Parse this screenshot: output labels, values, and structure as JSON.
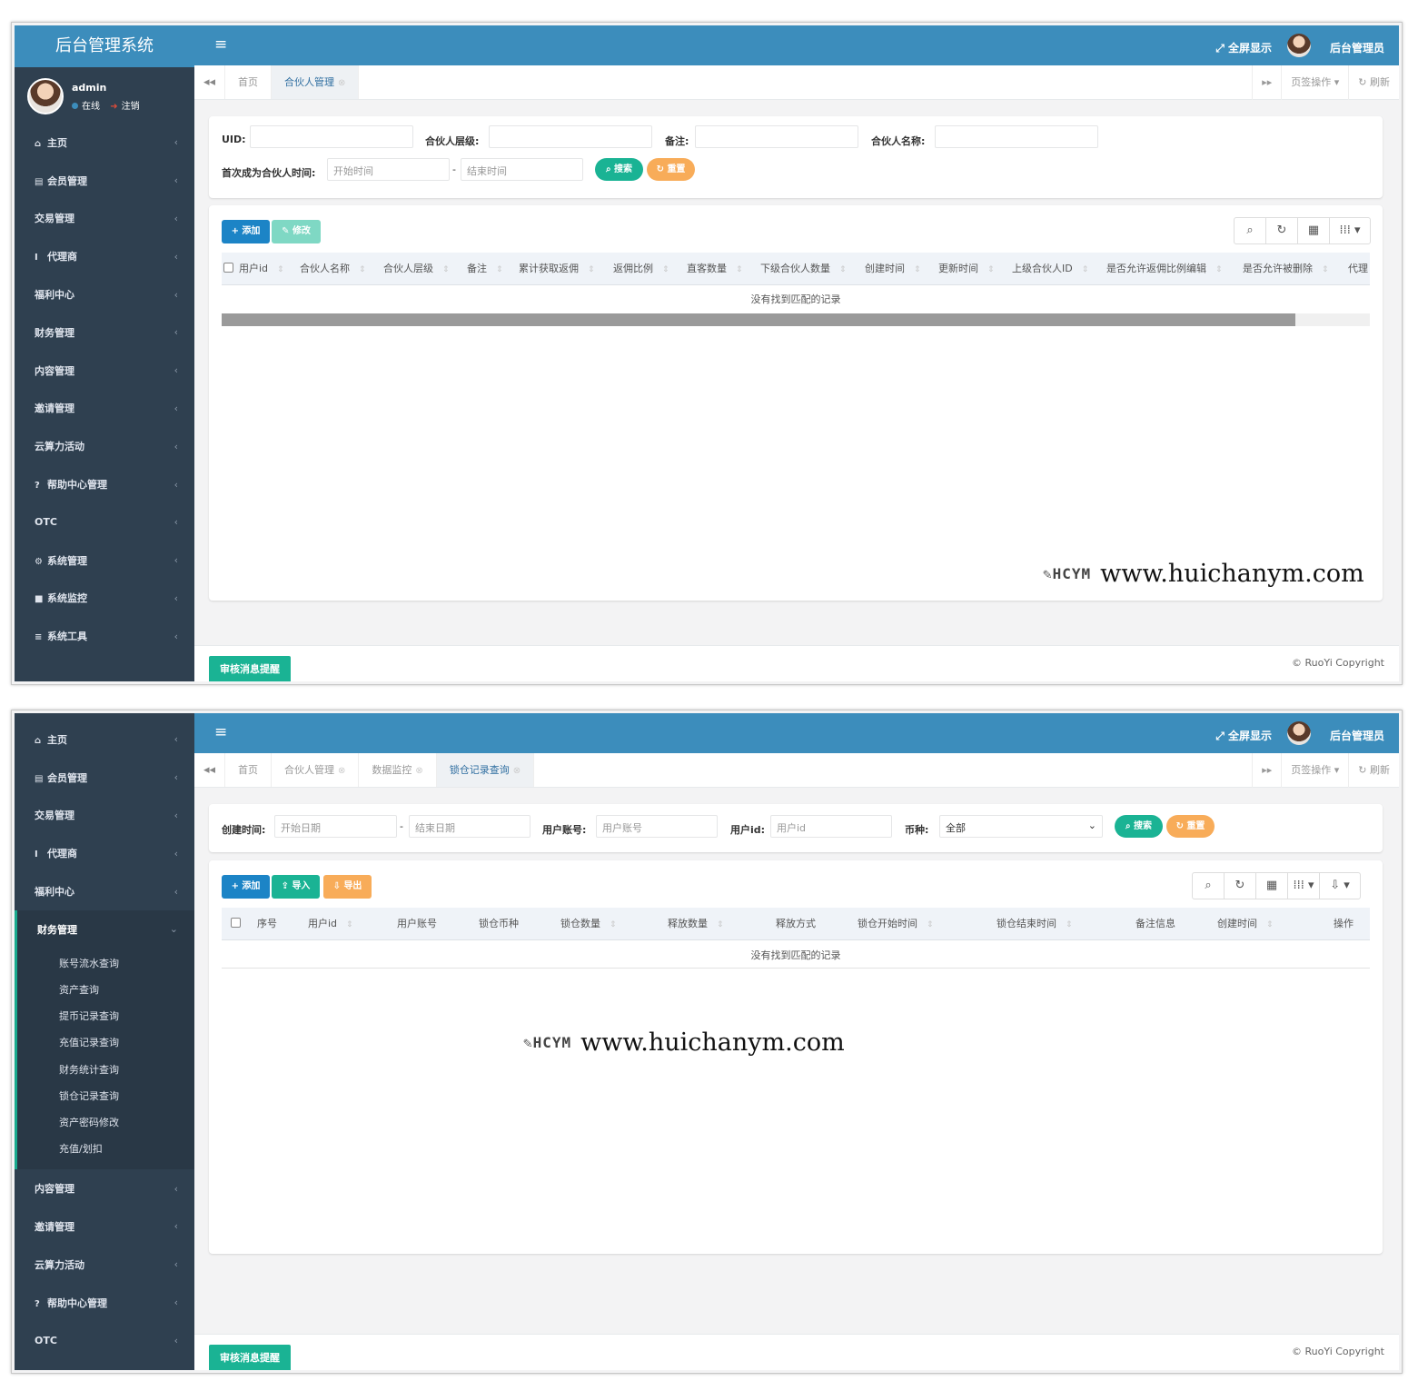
{
  "brand": "后台管理系统",
  "user": {
    "name": "admin",
    "status": "在线",
    "logout": "注销"
  },
  "topbar": {
    "menu_icon": "≡",
    "fullscreen": "全屏显示",
    "admin": "后台管理员"
  },
  "tabbar": {
    "prev_icon": "◂◂",
    "next_icon": "▸▸",
    "page_ops": "页签操作 ▾",
    "refresh": "刷新"
  },
  "sidebar1": [
    {
      "icon": "home-icon",
      "glyph": "⌂",
      "label": "主页"
    },
    {
      "icon": "id-card-icon",
      "glyph": "▤",
      "label": "会员管理"
    },
    {
      "icon": "",
      "glyph": "",
      "label": "交易管理"
    },
    {
      "icon": "agent-icon",
      "glyph": "I",
      "label": "代理商"
    },
    {
      "icon": "",
      "glyph": "",
      "label": "福利中心"
    },
    {
      "icon": "",
      "glyph": "",
      "label": "财务管理"
    },
    {
      "icon": "",
      "glyph": "",
      "label": "内容管理"
    },
    {
      "icon": "",
      "glyph": "",
      "label": "邀请管理"
    },
    {
      "icon": "",
      "glyph": "",
      "label": "云算力活动"
    },
    {
      "icon": "question-icon",
      "glyph": "?",
      "label": "帮助中心管理"
    },
    {
      "icon": "",
      "glyph": "",
      "label": "OTC"
    },
    {
      "icon": "gear-icon",
      "glyph": "⚙",
      "label": "系统管理"
    },
    {
      "icon": "video-icon",
      "glyph": "■",
      "label": "系统监控"
    },
    {
      "icon": "bars-icon",
      "glyph": "≡",
      "label": "系统工具"
    }
  ],
  "screen1": {
    "tabs": [
      {
        "label": "首页",
        "closable": false
      },
      {
        "label": "合伙人管理",
        "closable": true
      }
    ],
    "search": {
      "uid_label": "UID:",
      "level_label": "合伙人层级:",
      "remark_label": "备注:",
      "name_label": "合伙人名称:",
      "time_label": "首次成为合伙人时间:",
      "start_placeholder": "开始时间",
      "end_placeholder": "结束时间",
      "dash": "-",
      "search_btn": "搜索",
      "reset_btn": "重置"
    },
    "toolbar": {
      "add": "+ 添加",
      "edit": "修改"
    },
    "columns": [
      "用户id",
      "合伙人名称",
      "合伙人层级",
      "备注",
      "累计获取返佣",
      "返佣比例",
      "直客数量",
      "下级合伙人数量",
      "创建时间",
      "更新时间",
      "上级合伙人ID",
      "是否允许返佣比例编辑",
      "是否允许被删除",
      "代理"
    ],
    "empty": "没有找到匹配的记录"
  },
  "sidebar2_top": [
    {
      "icon": "home-icon",
      "glyph": "⌂",
      "label": "主页"
    },
    {
      "icon": "id-card-icon",
      "glyph": "▤",
      "label": "会员管理"
    },
    {
      "icon": "",
      "glyph": "",
      "label": "交易管理"
    },
    {
      "icon": "agent-icon",
      "glyph": "I",
      "label": "代理商"
    },
    {
      "icon": "",
      "glyph": "",
      "label": "福利中心"
    }
  ],
  "sidebar2_active": "财务管理",
  "sidebar2_sub": [
    "账号流水查询",
    "资产查询",
    "提币记录查询",
    "充值记录查询",
    "财务统计查询",
    "锁仓记录查询",
    "资产密码修改",
    "充值/划扣"
  ],
  "sidebar2_bottom": [
    {
      "icon": "",
      "glyph": "",
      "label": "内容管理"
    },
    {
      "icon": "",
      "glyph": "",
      "label": "邀请管理"
    },
    {
      "icon": "",
      "glyph": "",
      "label": "云算力活动"
    },
    {
      "icon": "question-icon",
      "glyph": "?",
      "label": "帮助中心管理"
    },
    {
      "icon": "",
      "glyph": "",
      "label": "OTC"
    }
  ],
  "screen2": {
    "tabs": [
      {
        "label": "首页",
        "closable": false
      },
      {
        "label": "合伙人管理",
        "closable": true
      },
      {
        "label": "数据监控",
        "closable": true
      },
      {
        "label": "锁仓记录查询",
        "closable": true
      }
    ],
    "search": {
      "time_label": "创建时间:",
      "start_placeholder": "开始日期",
      "end_placeholder": "结束日期",
      "dash": "-",
      "account_label": "用户账号:",
      "account_placeholder": "用户账号",
      "uid_label": "用户id:",
      "uid_placeholder": "用户id",
      "coin_label": "币种:",
      "coin_value": "全部",
      "search_btn": "搜索",
      "reset_btn": "重置"
    },
    "toolbar": {
      "add": "+ 添加",
      "import": "导入",
      "export": "导出"
    },
    "columns": [
      "序号",
      "用户id",
      "用户账号",
      "锁仓币种",
      "锁仓数量",
      "释放数量",
      "释放方式",
      "锁仓开始时间",
      "锁仓结束时间",
      "备注信息",
      "创建时间",
      "操作"
    ],
    "empty": "没有找到匹配的记录"
  },
  "watermark": {
    "logo": "HCYM",
    "url": "www.huichanym.com"
  },
  "footer": {
    "audit": "审核消息提醒",
    "copyright": "© RuoYi Copyright"
  },
  "colors": {
    "primary": "#3c8dbc",
    "sidebar": "#2f4050",
    "green": "#1ab394",
    "orange": "#f8ac59",
    "blue_btn": "#1c84c6"
  }
}
